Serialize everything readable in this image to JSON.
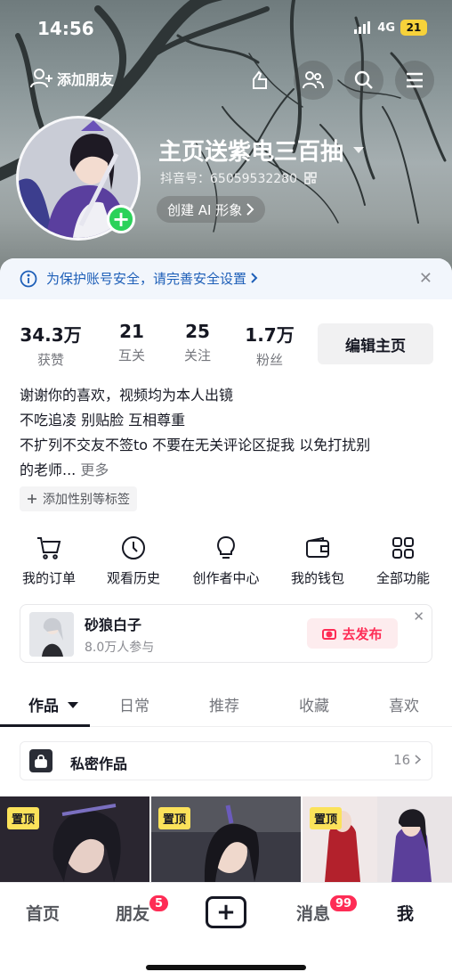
{
  "status": {
    "time": "14:56",
    "network": "4G",
    "battery": "21"
  },
  "topbar": {
    "add_friend_label": "添加朋友"
  },
  "profile": {
    "nickname": "主页送紫电三百抽",
    "douyin_id": "抖音号：65059532280",
    "create_ai_label": "创建 AI 形象"
  },
  "notice": {
    "text": "为保护账号安全，请完善安全设置"
  },
  "stats": [
    {
      "value": "34.3万",
      "label": "获赞"
    },
    {
      "value": "21",
      "label": "互关"
    },
    {
      "value": "25",
      "label": "关注"
    },
    {
      "value": "1.7万",
      "label": "粉丝"
    }
  ],
  "edit_profile_label": "编辑主页",
  "bio": {
    "line1": "谢谢你的喜欢，视频均为本人出镜",
    "line2": "不吃追凌 别贴脸 互相尊重",
    "line3": "不扩列不交友不签to  不要在无关评论区捉我 以免打扰别",
    "line4": "的老师...",
    "more": "更多"
  },
  "tag_chip_label": "添加性别等标签",
  "quick_actions": [
    {
      "label": "我的订单",
      "icon": "cart-icon"
    },
    {
      "label": "观看历史",
      "icon": "clock-icon"
    },
    {
      "label": "创作者中心",
      "icon": "bulb-icon"
    },
    {
      "label": "我的钱包",
      "icon": "wallet-icon"
    },
    {
      "label": "全部功能",
      "icon": "grid-icon"
    }
  ],
  "promo": {
    "title": "砂狼白子",
    "subtitle": "8.0万人参与",
    "button_label": "去发布"
  },
  "tabs": [
    {
      "label": "作品",
      "active": true
    },
    {
      "label": "日常",
      "active": false
    },
    {
      "label": "推荐",
      "active": false
    },
    {
      "label": "收藏",
      "active": false
    },
    {
      "label": "喜欢",
      "active": false
    }
  ],
  "private_works": {
    "label": "私密作品",
    "count": "16"
  },
  "grid": {
    "pin_label": "置顶"
  },
  "bottom_nav": [
    {
      "label": "首页",
      "active": false
    },
    {
      "label": "朋友",
      "active": false,
      "badge": "5"
    },
    {
      "label": "消息",
      "active": false,
      "badge": "99"
    },
    {
      "label": "我",
      "active": true
    }
  ],
  "colors": {
    "accent_red": "#fe2c55",
    "notice_blue": "#1e5fb8",
    "pin_yellow": "#fbe25a",
    "plus_green": "#2bd25a"
  }
}
